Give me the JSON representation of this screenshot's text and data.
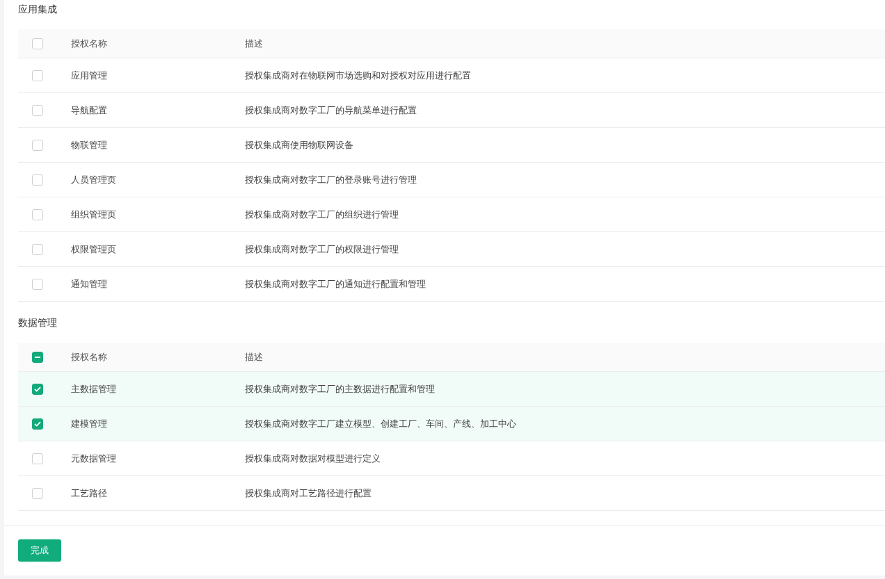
{
  "sections": [
    {
      "title": "应用集成",
      "header": {
        "partial": false,
        "columns": [
          "授权名称",
          "描述"
        ]
      },
      "rows": [
        {
          "name": "应用管理",
          "description": "授权集成商对在物联网市场选购和对授权对应用进行配置",
          "checked": false
        },
        {
          "name": "导航配置",
          "description": "授权集成商对数字工厂的导航菜单进行配置",
          "checked": false
        },
        {
          "name": "物联管理",
          "description": "授权集成商使用物联网设备",
          "checked": false
        },
        {
          "name": "人员管理页",
          "description": "授权集成商对数字工厂的登录账号进行管理",
          "checked": false
        },
        {
          "name": "组织管理页",
          "description": "授权集成商对数字工厂的组织进行管理",
          "checked": false
        },
        {
          "name": "权限管理页",
          "description": "授权集成商对数字工厂的权限进行管理",
          "checked": false
        },
        {
          "name": "通知管理",
          "description": "授权集成商对数字工厂的通知进行配置和管理",
          "checked": false
        }
      ]
    },
    {
      "title": "数据管理",
      "header": {
        "partial": true,
        "columns": [
          "授权名称",
          "描述"
        ]
      },
      "rows": [
        {
          "name": "主数据管理",
          "description": "授权集成商对数字工厂的主数据进行配置和管理",
          "checked": true
        },
        {
          "name": "建模管理",
          "description": "授权集成商对数字工厂建立模型、创建工厂、车间、产线、加工中心",
          "checked": true
        },
        {
          "name": "元数据管理",
          "description": "授权集成商对数据对模型进行定义",
          "checked": false
        },
        {
          "name": "工艺路径",
          "description": "授权集成商对工艺路径进行配置",
          "checked": false
        }
      ]
    }
  ],
  "submit_button": "完成"
}
